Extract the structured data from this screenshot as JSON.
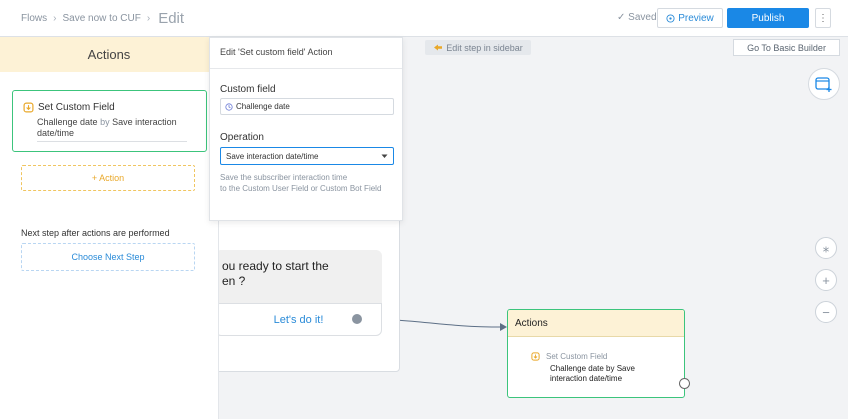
{
  "topbar": {
    "breadcrumbs": [
      "Flows",
      "Save now to CUF"
    ],
    "current": "Edit",
    "saved": "✓ Saved",
    "preview": "Preview",
    "publish": "Publish",
    "more": "⋮"
  },
  "canvas": {
    "edit_hint": "Edit step in sidebar",
    "basic_builder": "Go To Basic Builder",
    "zoom_controls": [
      "⁎",
      "+",
      "−"
    ]
  },
  "sidebar": {
    "header": "Actions",
    "action": {
      "title": "Set Custom Field",
      "field": "Challenge date",
      "by": "by",
      "operation": "Save interaction date/time"
    },
    "add_action": "+ Action",
    "next_step_label": "Next step after actions are performed",
    "choose_next": "Choose Next Step"
  },
  "edit_panel": {
    "title": "Edit 'Set custom field' Action",
    "custom_field_label": "Custom field",
    "custom_field_value": "Challenge date",
    "operation_label": "Operation",
    "operation_value": "Save interaction date/time",
    "help_line1": "Save the subscriber interaction time",
    "help_line2": "to the Custom User Field or Custom Bot Field"
  },
  "message_node": {
    "text_line1": "ou ready to start the",
    "text_line2": "en ?",
    "button": "Let's do it!"
  },
  "actions_node": {
    "header": "Actions",
    "item_title": "Set Custom Field",
    "item_desc": "Challenge date by Save interaction date/time"
  },
  "colors": {
    "accent_blue": "#1a88e6",
    "green_border": "#3cc47c",
    "header_yellow": "#fdf2d6"
  }
}
